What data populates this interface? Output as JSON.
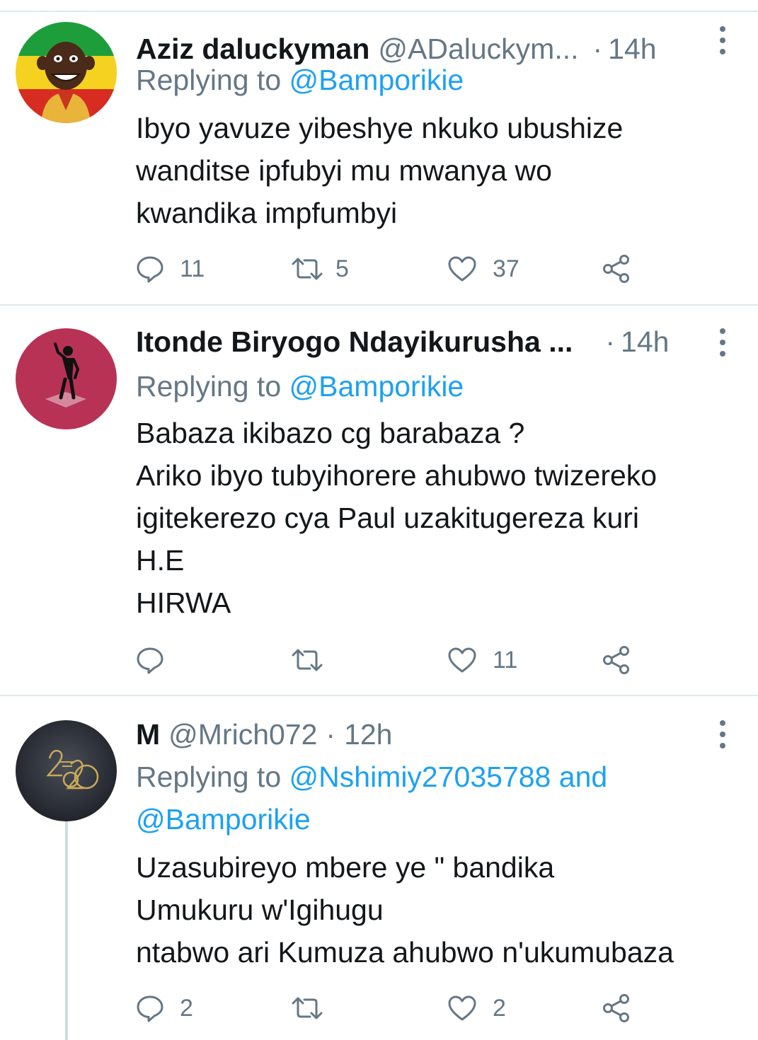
{
  "reply_prefix": "Replying to",
  "tweets": [
    {
      "name": "Aziz daluckyman",
      "handle": "@ADaluckym...",
      "dot": "·",
      "time": "14h",
      "mention_1": "@Bamporikie",
      "mention_2": "",
      "mention_3": "",
      "text": "Ibyo yavuze yibeshye nkuko ubushize\nwanditse ipfubyi mu mwanya wo\nkwandika impfumbyi",
      "replies": "11",
      "retweets": "5",
      "likes": "37"
    },
    {
      "name": "Itonde Biryogo Ndayikurusha ...",
      "handle": "",
      "dot": "·",
      "time": "14h",
      "mention_1": "@Bamporikie",
      "mention_2": "",
      "mention_3": "",
      "text": "Babaza ikibazo cg barabaza ?\nAriko ibyo tubyihorere ahubwo twizereko\nigitekerezo cya Paul uzakitugereza kuri\nH.E\nHIRWA",
      "replies": "",
      "retweets": "",
      "likes": "11"
    },
    {
      "name": "M",
      "handle": "@Mrich072",
      "dot": "·",
      "time": "12h",
      "mention_1": "@Nshimiy27035788",
      "mention_2": "and",
      "mention_3": "@Bamporikie",
      "text": "Uzasubireyo mbere ye  \" bandika\nUmukuru w'Igihugu\nntabwo ari Kumuza ahubwo n'ukumubaza",
      "replies": "2",
      "retweets": "",
      "likes": "2"
    }
  ],
  "icons": {
    "reply": "reply-icon",
    "retweet": "retweet-icon",
    "like": "heart-icon",
    "share": "share-icon",
    "more": "more-vertical-icon"
  },
  "colors": {
    "text": "#14171a",
    "secondary": "#657786",
    "link": "#1da1f2",
    "border": "#e1e8ed"
  }
}
